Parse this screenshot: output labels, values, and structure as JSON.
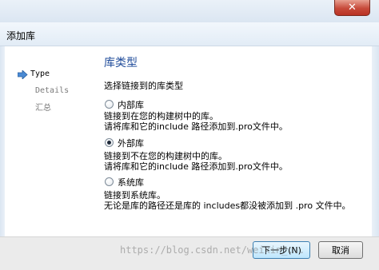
{
  "window": {
    "title": "添加库",
    "close_glyph": "✕"
  },
  "wizard": {
    "steps": [
      {
        "label": "Type",
        "active": true
      },
      {
        "label": "Details",
        "active": false
      },
      {
        "label": "汇总",
        "active": false
      }
    ],
    "heading": "库类型",
    "prompt": "选择链接到的库类型",
    "options": [
      {
        "label": "内部库",
        "checked": false,
        "desc_line1": "链接到在您的构建树中的库。",
        "desc_line2": "请将库和它的include 路径添加到.pro文件中。"
      },
      {
        "label": "外部库",
        "checked": true,
        "desc_line1": "链接到不在您的构建树中的库。",
        "desc_line2": "请将库和它的include 路径添加到.pro文件中。"
      },
      {
        "label": "系统库",
        "checked": false,
        "desc_line1": "链接到系统库。",
        "desc_line2": "无论是库的路径还是库的 includes都没被添加到 .pro 文件中。"
      }
    ]
  },
  "buttons": {
    "next": "下一步(N)",
    "cancel": "取消"
  },
  "watermark": "https://blog.csdn.net/weixin_..."
}
